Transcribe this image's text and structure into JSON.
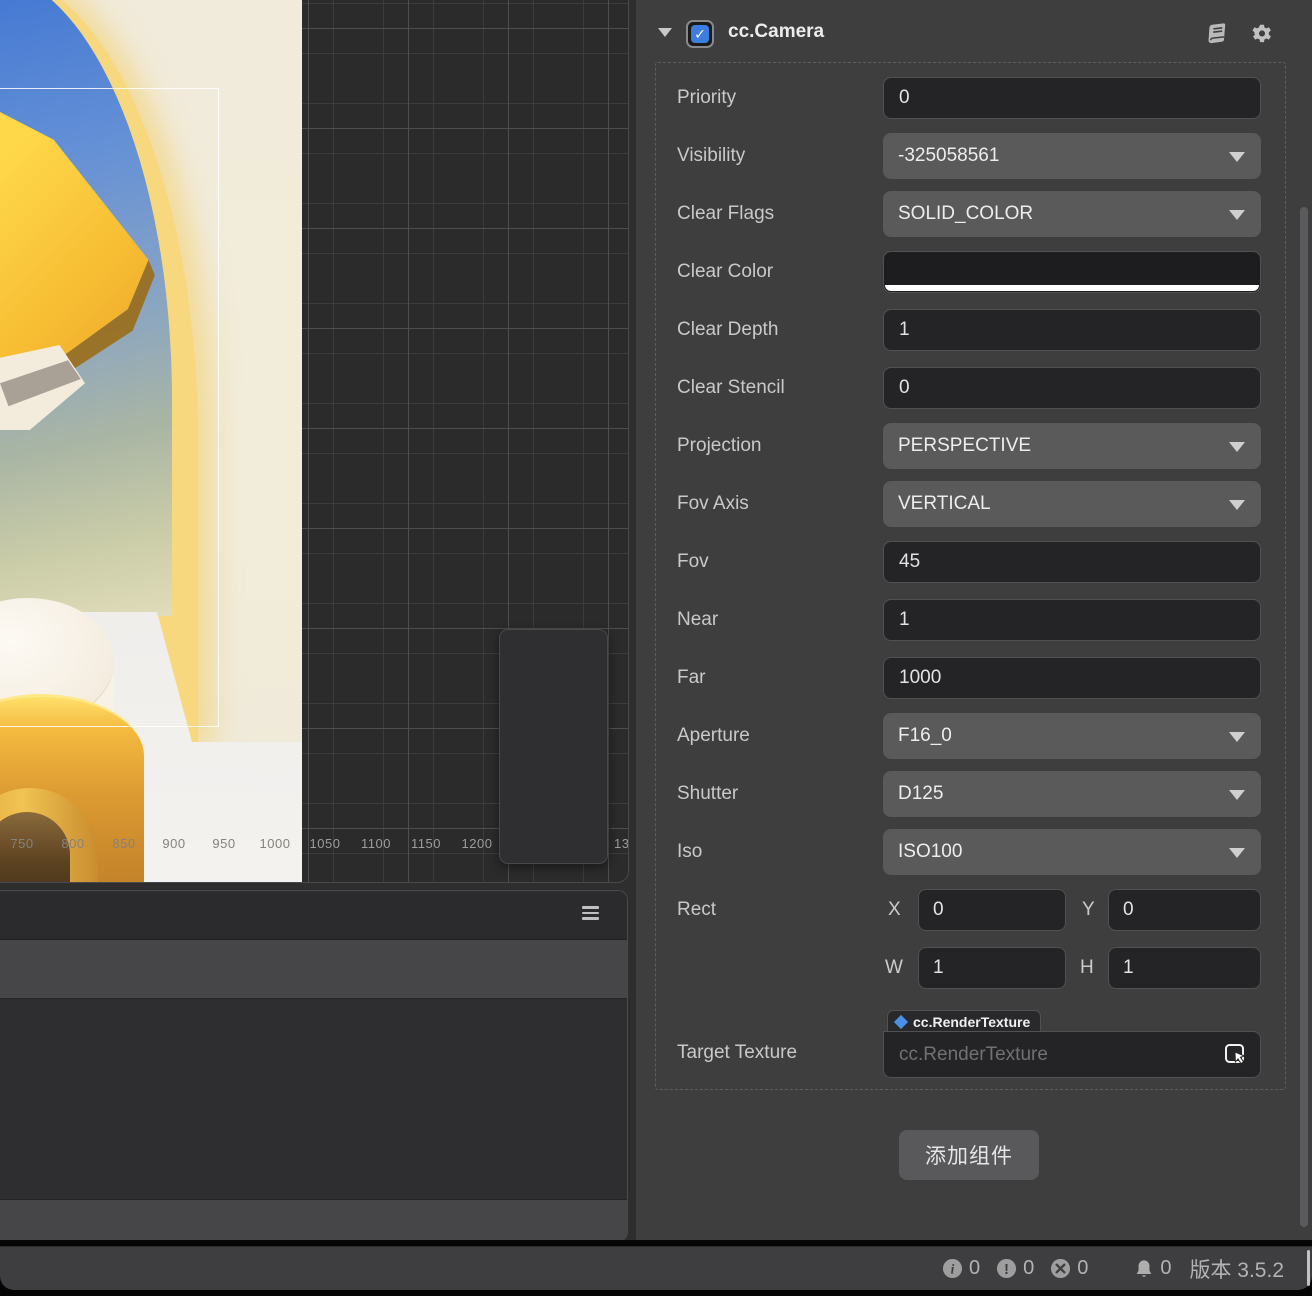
{
  "scene_view": {
    "ruler_labels": [
      "750",
      "800",
      "850",
      "900",
      "950",
      "1000",
      "1050",
      "1100",
      "1150",
      "1200",
      "13"
    ]
  },
  "inspector": {
    "header": {
      "component_name": "cc.Camera",
      "enabled": true
    },
    "rows": [
      {
        "label": "Priority",
        "type": "input",
        "value": "0"
      },
      {
        "label": "Visibility",
        "type": "select",
        "value": "-325058561"
      },
      {
        "label": "Clear Flags",
        "type": "select",
        "value": "SOLID_COLOR"
      },
      {
        "label": "Clear Color",
        "type": "color",
        "value": "#1d1d1f"
      },
      {
        "label": "Clear Depth",
        "type": "input",
        "value": "1"
      },
      {
        "label": "Clear Stencil",
        "type": "input",
        "value": "0"
      },
      {
        "label": "Projection",
        "type": "select",
        "value": "PERSPECTIVE"
      },
      {
        "label": "Fov Axis",
        "type": "select",
        "value": "VERTICAL"
      },
      {
        "label": "Fov",
        "type": "input",
        "value": "45"
      },
      {
        "label": "Near",
        "type": "input",
        "value": "1"
      },
      {
        "label": "Far",
        "type": "input",
        "value": "1000"
      },
      {
        "label": "Aperture",
        "type": "select",
        "value": "F16_0"
      },
      {
        "label": "Shutter",
        "type": "select",
        "value": "D125"
      },
      {
        "label": "Iso",
        "type": "select",
        "value": "ISO100"
      }
    ],
    "rect": {
      "label": "Rect",
      "x_label": "X",
      "x_value": "0",
      "y_label": "Y",
      "y_value": "0",
      "w_label": "W",
      "w_value": "1",
      "h_label": "H",
      "h_value": "1"
    },
    "target_texture": {
      "label": "Target Texture",
      "tag": "cc.RenderTexture",
      "placeholder": "cc.RenderTexture"
    },
    "add_component_label": "添加组件"
  },
  "status_bar": {
    "info_count": "0",
    "warning_count": "0",
    "error_count": "0",
    "notification_count": "0",
    "version_label": "版本 3.5.2"
  },
  "colors": {
    "accent_blue": "#3c7ee0",
    "inspector_bg": "#3e3e3f",
    "input_bg": "#242426",
    "select_bg": "#5a5a5b",
    "grid_bg": "#2b2b2c"
  }
}
